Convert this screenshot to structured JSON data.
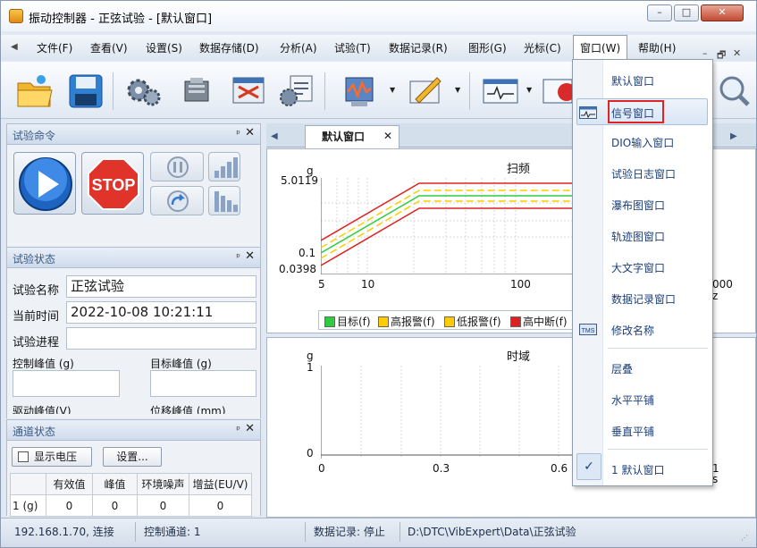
{
  "window": {
    "title": "振动控制器 - 正弦试验 - [默认窗口]",
    "minimize": "–",
    "maximize": "□",
    "close": "✕"
  },
  "menu": {
    "back_arrow": "◀",
    "items": [
      "文件(F)",
      "查看(V)",
      "设置(S)",
      "数据存储(D)",
      "分析(A)",
      "试验(T)",
      "数据记录(R)",
      "图形(G)",
      "光标(C)",
      "窗口(W)",
      "帮助(H)"
    ],
    "mdi_min": "–",
    "mdi_restore": "🗗",
    "mdi_close": "✕"
  },
  "panels": {
    "command": {
      "title": "试验命令",
      "pin": "📌",
      "close": "✕"
    },
    "status": {
      "title": "试验状态",
      "name_label": "试验名称",
      "name_value": "正弦试验",
      "time_label": "当前时间",
      "time_value": "2022-10-08 10:21:11",
      "progress_label": "试验进程",
      "control_peak_label": "控制峰值 (g)",
      "target_peak_label": "目标峰值 (g)",
      "drive_peak_label": "驱动峰值(V)",
      "disp_peak_label": "位移峰值 (mm)"
    },
    "channel": {
      "title": "通道状态",
      "show_voltage": "显示电压",
      "settings_button": "设置...",
      "columns": [
        "有效值",
        "峰值",
        "环境噪声",
        "增益(EU/V)"
      ],
      "rows": [
        {
          "label": "1 (g)",
          "values": [
            "0",
            "0",
            "0",
            "0"
          ]
        }
      ]
    }
  },
  "tabs": {
    "left_arrow": "◀",
    "right_arrow": "▶",
    "active": "默认窗口",
    "close": "✕"
  },
  "sweep_chart": {
    "title": "扫频",
    "unit_y": "g",
    "unit_x_partial": "z",
    "yticks": [
      "5.0119",
      "0.1",
      "0.0398"
    ],
    "xticks": [
      "5",
      "10",
      "100",
      "000"
    ],
    "legend": [
      {
        "label": "目标(f)",
        "color": "#2ecc40"
      },
      {
        "label": "高报警(f)",
        "color": "#ffcc00"
      },
      {
        "label": "低报警(f)",
        "color": "#ffcc00"
      },
      {
        "label": "高中断(f)",
        "color": "#e02020"
      }
    ]
  },
  "time_chart": {
    "title": "时域",
    "unit_y": "g",
    "unit_x_partial": "s",
    "yticks": [
      "1",
      "0"
    ],
    "xticks": [
      "0",
      "0.3",
      "0.6",
      "1"
    ]
  },
  "dropdown": {
    "items": [
      "默认窗口",
      "信号窗口",
      "DIO输入窗口",
      "试验日志窗口",
      "瀑布图窗口",
      "轨迹图窗口",
      "大文字窗口",
      "数据记录窗口",
      "修改名称"
    ],
    "arrange": [
      "层叠",
      "水平平铺",
      "垂直平铺"
    ],
    "open_windows": [
      "1 默认窗口"
    ],
    "check": "✓",
    "rename_icon_text": "TMS"
  },
  "statusbar": {
    "connection": "192.168.1.70, 连接",
    "control_channel": "控制通道: 1",
    "data_record": "数据记录: 停止",
    "path": "D:\\DTC\\VibExpert\\Data\\正弦试验"
  }
}
